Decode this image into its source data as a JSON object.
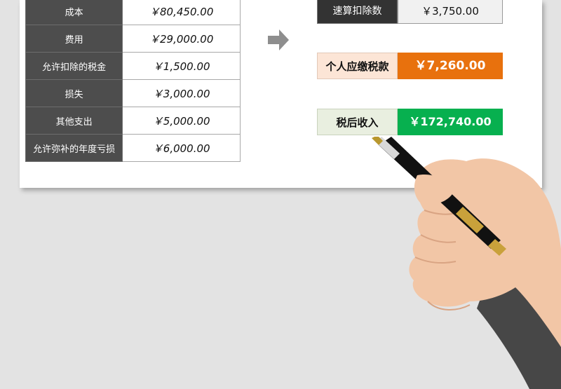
{
  "left_table": {
    "rows": [
      {
        "label": "成本",
        "value": "￥80,450.00"
      },
      {
        "label": "费用",
        "value": "￥29,000.00"
      },
      {
        "label": "允许扣除的税金",
        "value": "￥1,500.00"
      },
      {
        "label": "损失",
        "value": "￥3,000.00"
      },
      {
        "label": "其他支出",
        "value": "￥5,000.00"
      },
      {
        "label": "允许弥补的年度亏损",
        "value": "￥6,000.00"
      }
    ]
  },
  "results": {
    "quick_deduction": {
      "label": "速算扣除数",
      "value": "￥3,750.00"
    },
    "tax_payable": {
      "label": "个人应缴税款",
      "value": "￥7,260.00"
    },
    "after_tax_income": {
      "label": "税后收入",
      "value": "￥172,740.00"
    }
  },
  "icons": {
    "arrow": "arrow-right-icon",
    "hand": "hand-with-pen-icon"
  },
  "colors": {
    "label_dark": "#4d4d4d",
    "tax_payable_accent": "#e8710d",
    "after_tax_accent": "#07b04f",
    "page_background": "#e3e3e3"
  }
}
